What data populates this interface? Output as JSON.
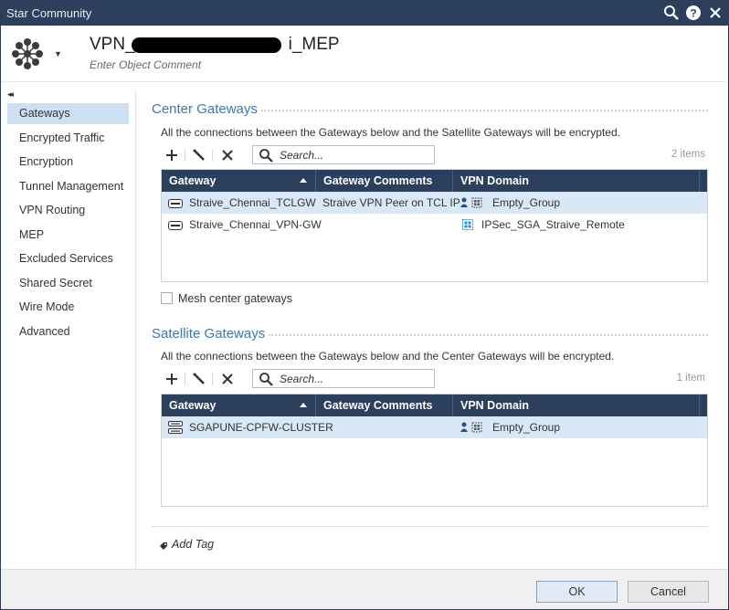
{
  "window": {
    "title": "Star Community"
  },
  "header": {
    "name_prefix": "VPN_",
    "name_suffix": "i_MEP",
    "comment_placeholder": "Enter Object Comment"
  },
  "sidebar": {
    "items": [
      {
        "label": "Gateways",
        "active": true
      },
      {
        "label": "Encrypted Traffic"
      },
      {
        "label": "Encryption"
      },
      {
        "label": "Tunnel Management"
      },
      {
        "label": "VPN Routing"
      },
      {
        "label": "MEP"
      },
      {
        "label": "Excluded Services"
      },
      {
        "label": "Shared Secret"
      },
      {
        "label": "Wire Mode"
      },
      {
        "label": "Advanced"
      }
    ]
  },
  "center": {
    "title": "Center Gateways",
    "description": "All the connections between the Gateways below and the Satellite Gateways will be encrypted.",
    "search_placeholder": "Search...",
    "count": "2 items",
    "columns": [
      "Gateway",
      "Gateway Comments",
      "VPN Domain"
    ],
    "rows": [
      {
        "gateway": "Straive_Chennai_TCLGW",
        "comment": "Straive VPN Peer on TCL IP",
        "domain": "Empty_Group",
        "selected": true
      },
      {
        "gateway": "Straive_Chennai_VPN-GW",
        "comment": "",
        "domain": "IPSec_SGA_Straive_Remote"
      }
    ],
    "mesh_label": "Mesh center gateways"
  },
  "satellite": {
    "title": "Satellite Gateways",
    "description": "All the connections between the Gateways below and the Center Gateways will be encrypted.",
    "search_placeholder": "Search...",
    "count": "1 item",
    "columns": [
      "Gateway",
      "Gateway Comments",
      "VPN Domain"
    ],
    "rows": [
      {
        "gateway": "SGAPUNE-CPFW-CLUSTER",
        "comment": "",
        "domain": "Empty_Group",
        "selected": true
      }
    ]
  },
  "add_tag": "Add Tag",
  "footer": {
    "ok": "OK",
    "cancel": "Cancel"
  },
  "colors": {
    "titlebar": "#2c3f5c",
    "accent": "#3a78b5",
    "selection": "#d9e8f6"
  }
}
